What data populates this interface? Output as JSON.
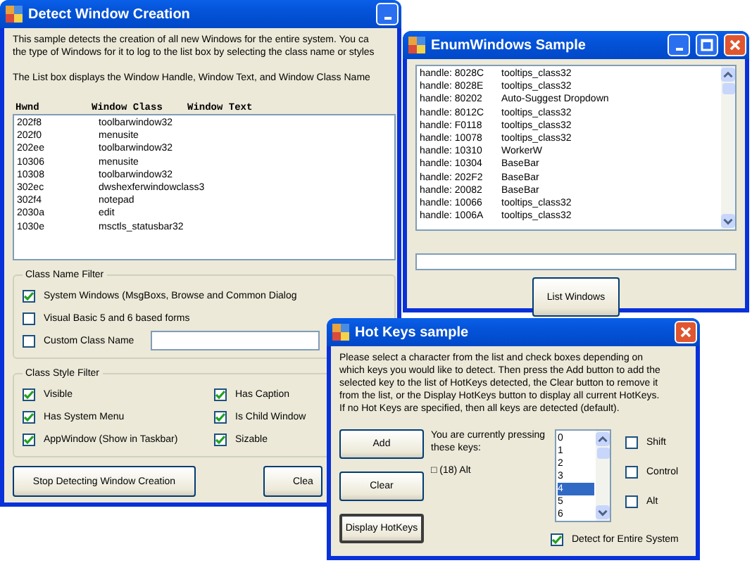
{
  "detect_window": {
    "title": "Detect Window Creation",
    "description": [
      "This sample detects the creation of all new Windows for the entire system. You ca",
      "the type of Windows for it to log to the list box by selecting the class name or styles"
    ],
    "list_note": "The List box displays the Window Handle, Window Text, and Window Class Name",
    "columns": [
      "Hwnd",
      "Window Class",
      "Window Text"
    ],
    "rows": [
      {
        "hwnd": "202f8",
        "window_class": "toolbarwindow32"
      },
      {
        "hwnd": "202f0",
        "window_class": "menusite"
      },
      {
        "hwnd": "202ee",
        "window_class": "toolbarwindow32"
      },
      {
        "hwnd": "10306",
        "window_class": "menusite"
      },
      {
        "hwnd": "10308",
        "window_class": "toolbarwindow32"
      },
      {
        "hwnd": "302ec",
        "window_class": "dwshexferwindowclass3"
      },
      {
        "hwnd": "302f4",
        "window_class": "notepad"
      },
      {
        "hwnd": "2030a",
        "window_class": "edit"
      },
      {
        "hwnd": "1030e",
        "window_class": "msctls_statusbar32"
      }
    ],
    "class_name_filter": {
      "title": "Class Name Filter",
      "options": [
        {
          "kind": "checkbox",
          "label": "System Windows (MsgBoxs, Browse and Common Dialog",
          "checked": true
        },
        {
          "kind": "checkbox",
          "label": "Visual Basic 5 and 6 based forms",
          "checked": false
        },
        {
          "kind": "checkbox_with_field",
          "label": "Custom Class Name",
          "checked": false
        }
      ]
    },
    "class_style_filter": {
      "title": "Class Style Filter",
      "options": [
        {
          "label": "Visible",
          "checked": true
        },
        {
          "label": "Has Caption",
          "checked": true
        },
        {
          "label": "Has System Menu",
          "checked": true
        },
        {
          "label": "Is Child Window",
          "checked": true
        },
        {
          "label": "AppWindow (Show in Taskbar)",
          "checked": true
        },
        {
          "label": "Sizable",
          "checked": true
        }
      ]
    },
    "buttons": [
      "Stop Detecting Window Creation",
      "Clea"
    ]
  },
  "enum_window": {
    "title": "EnumWindows Sample",
    "rows": [
      {
        "handle": "handle: 8028C",
        "window_class": "tooltips_class32"
      },
      {
        "handle": "handle: 8028E",
        "window_class": "tooltips_class32"
      },
      {
        "handle": "handle: 80202",
        "window_class": "Auto-Suggest Dropdown"
      },
      {
        "handle": "handle: 8012C",
        "window_class": "tooltips_class32"
      },
      {
        "handle": "handle: F0118",
        "window_class": "tooltips_class32"
      },
      {
        "handle": "handle: 10078",
        "window_class": "tooltips_class32"
      },
      {
        "handle": "handle: 10310",
        "window_class": "WorkerW"
      },
      {
        "handle": "handle: 10304",
        "window_class": "BaseBar"
      },
      {
        "handle": "handle: 202F2",
        "window_class": "BaseBar"
      },
      {
        "handle": "handle: 20082",
        "window_class": "BaseBar"
      },
      {
        "handle": "handle: 10066",
        "window_class": "tooltips_class32"
      },
      {
        "handle": "handle: 1006A",
        "window_class": "tooltips_class32"
      }
    ],
    "button": "List Windows"
  },
  "hotkeys_window": {
    "title": "Hot Keys sample",
    "description": [
      "Please select a character from the list and check boxes depending on",
      "which keys you would like to detect.  Then press the Add button to add the",
      "selected key to the list of HotKeys detected, the Clear button to remove it",
      "from the list, or the Display HotKeys button to display all current HotKeys.",
      "If no Hot Keys are specified, then all keys are detected (default)."
    ],
    "buttons": [
      {
        "label": "Add",
        "focused": false
      },
      {
        "label": "Clear",
        "focused": false
      },
      {
        "label": "Display HotKeys",
        "focused": true
      }
    ],
    "pressing_label": "You are currently pressing these keys:",
    "pressed_keys": "□ (18) Alt",
    "keys": [
      {
        "label": "0",
        "selected": false
      },
      {
        "label": "1",
        "selected": false
      },
      {
        "label": "2",
        "selected": false
      },
      {
        "label": "3",
        "selected": false
      },
      {
        "label": "4",
        "selected": true
      },
      {
        "label": "5",
        "selected": false
      },
      {
        "label": "6",
        "selected": false
      }
    ],
    "modifiers": [
      {
        "label": "Shift",
        "checked": false
      },
      {
        "label": "Control",
        "checked": false
      },
      {
        "label": "Alt",
        "checked": false
      }
    ],
    "detect_entire_system": {
      "label": "Detect for Entire System",
      "checked": true
    }
  }
}
